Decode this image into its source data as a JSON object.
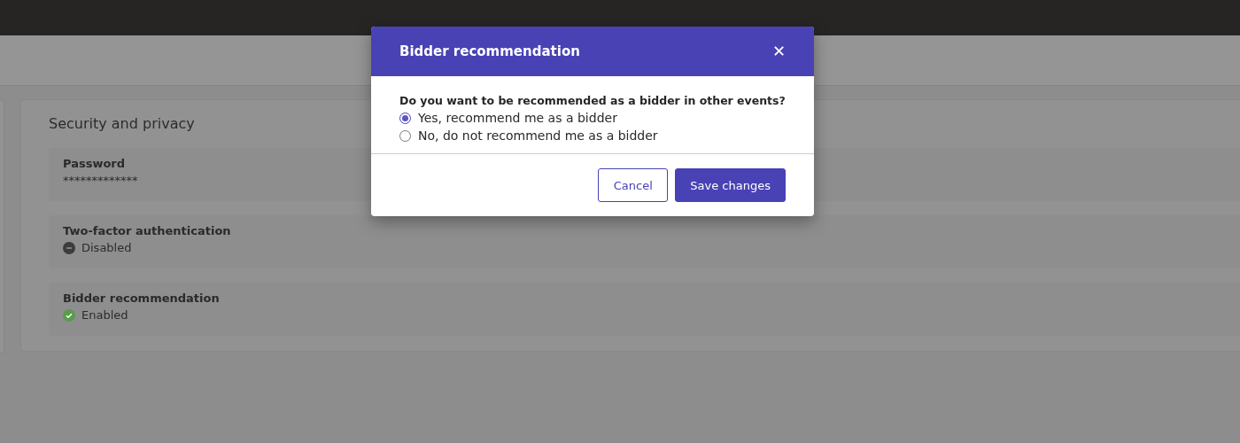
{
  "section": {
    "title": "Security and privacy",
    "items": [
      {
        "label": "Password",
        "value": "*************",
        "kind": "text"
      },
      {
        "label": "Two-factor authentication",
        "value": "Disabled",
        "kind": "disabled"
      },
      {
        "label": "Bidder recommendation",
        "value": "Enabled",
        "kind": "enabled"
      }
    ]
  },
  "dialog": {
    "title": "Bidder recommendation",
    "close": "✕",
    "question": "Do you want to be recommended as a bidder in other events?",
    "options": [
      {
        "label": "Yes, recommend me as a bidder",
        "selected": true
      },
      {
        "label": "No, do not recommend me as a bidder",
        "selected": false
      }
    ],
    "buttons": [
      {
        "label": "Cancel",
        "kind": "secondary"
      },
      {
        "label": "Save changes",
        "kind": "primary"
      }
    ]
  }
}
